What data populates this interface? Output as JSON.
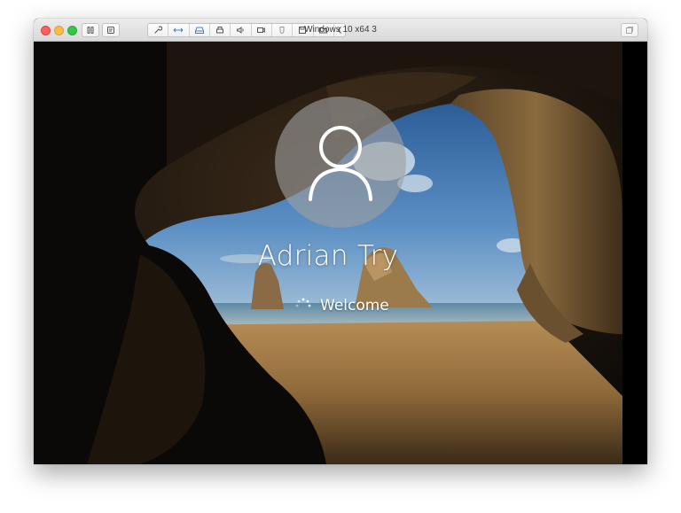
{
  "window": {
    "title": "Windows 10 x64 3"
  },
  "toolbar": {
    "left_buttons": [
      "pause-icon",
      "snapshot-icon"
    ],
    "tools": [
      "wrench-icon",
      "network-icon",
      "hard-disk-icon",
      "printer-icon",
      "sound-icon",
      "camera-icon",
      "usb-icon",
      "floppy-icon",
      "shared-folder-icon",
      "chevron-left-icon"
    ],
    "right_button": "fullscreen-icon"
  },
  "login": {
    "username": "Adrian Try",
    "status": "Welcome"
  },
  "colors": {
    "avatar_bg": "#a0a0a0",
    "sky": "#3b6fa8",
    "sand": "#a8834f",
    "rock": "#3a2a1a"
  }
}
